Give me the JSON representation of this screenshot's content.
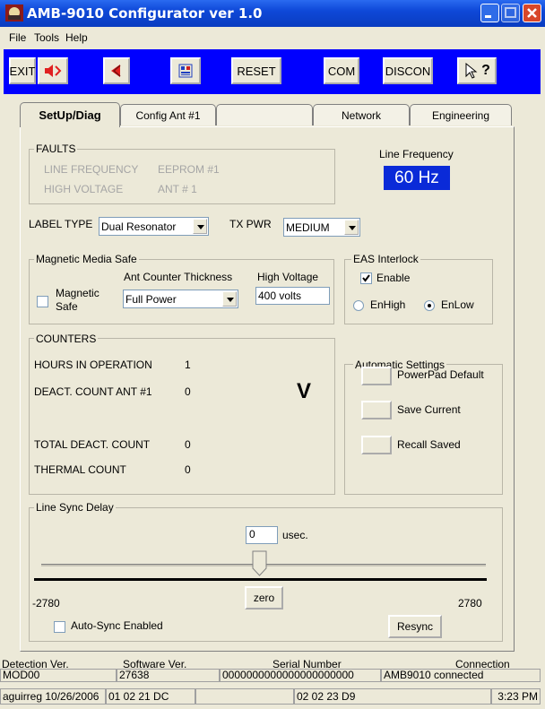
{
  "window": {
    "title": "AMB-9010 Configurator ver 1.0"
  },
  "menu": {
    "file": "File",
    "tools": "Tools",
    "help": "Help"
  },
  "toolbar": {
    "exit": "EXIT",
    "reset": "RESET",
    "com": "COM",
    "discon": "DISCON",
    "help_glyph": "?"
  },
  "tabs": [
    {
      "label": "SetUp/Diag"
    },
    {
      "label": "Config Ant #1"
    },
    {
      "label": ""
    },
    {
      "label": "Network"
    },
    {
      "label": "Engineering"
    }
  ],
  "faults": {
    "title": "FAULTS",
    "line_frequency": "LINE FREQUENCY",
    "eeprom": "EEPROM #1",
    "high_voltage": "HIGH VOLTAGE",
    "ant": "ANT # 1"
  },
  "line_frequency": {
    "label": "Line Frequency",
    "value": "60 Hz"
  },
  "label_type": {
    "label": "LABEL TYPE",
    "value": "Dual Resonator"
  },
  "tx_pwr": {
    "label": "TX PWR",
    "value": "MEDIUM"
  },
  "magnetic_media_safe": {
    "title": "Magnetic Media Safe",
    "ant_counter_label": "Ant Counter Thickness",
    "ant_counter_value": "Full Power",
    "high_voltage_label": "High Voltage",
    "high_voltage_value": "400 volts",
    "magnetic_safe_label1": "Magnetic",
    "magnetic_safe_label2": "Safe",
    "magnetic_safe_checked": false
  },
  "eas_interlock": {
    "title": "EAS Interlock",
    "enable_label": "Enable",
    "enable_checked": true,
    "enhigh": "EnHigh",
    "enlow": "EnLow",
    "selected": "EnLow"
  },
  "counters": {
    "title": "COUNTERS",
    "hours_label": "HOURS IN OPERATION",
    "hours_value": "1",
    "deact_ant_label": "DEACT. COUNT ANT #1",
    "deact_ant_value": "0",
    "indicator": "V",
    "total_deact_label": "TOTAL DEACT. COUNT",
    "total_deact_value": "0",
    "thermal_label": "THERMAL COUNT",
    "thermal_value": "0"
  },
  "automatic_settings": {
    "title": "Automatic Settings",
    "powerpad_default": "PowerPad Default",
    "save_current": "Save Current",
    "recall_saved": "Recall Saved"
  },
  "line_sync": {
    "title": "Line Sync Delay",
    "value": "0",
    "unit": "usec.",
    "min": "-2780",
    "max": "2780",
    "slider_level": 0.5,
    "zero_button": "zero",
    "auto_sync_label": "Auto-Sync Enabled",
    "auto_sync_checked": false,
    "resync_button": "Resync"
  },
  "status": {
    "detection_label": "Detection Ver.",
    "detection_value": "MOD00",
    "software_label": "Software Ver.",
    "software_value": "27638",
    "serial_label": "Serial Number",
    "serial_value": "0000000000000000000000",
    "connection_label": "Connection",
    "connection_value": "AMB9010 connected",
    "user_date": "aguirreg 10/26/2006",
    "code1": "01 02 21 DC",
    "code2": "02 02 23 D9",
    "time": "3:23 PM"
  }
}
